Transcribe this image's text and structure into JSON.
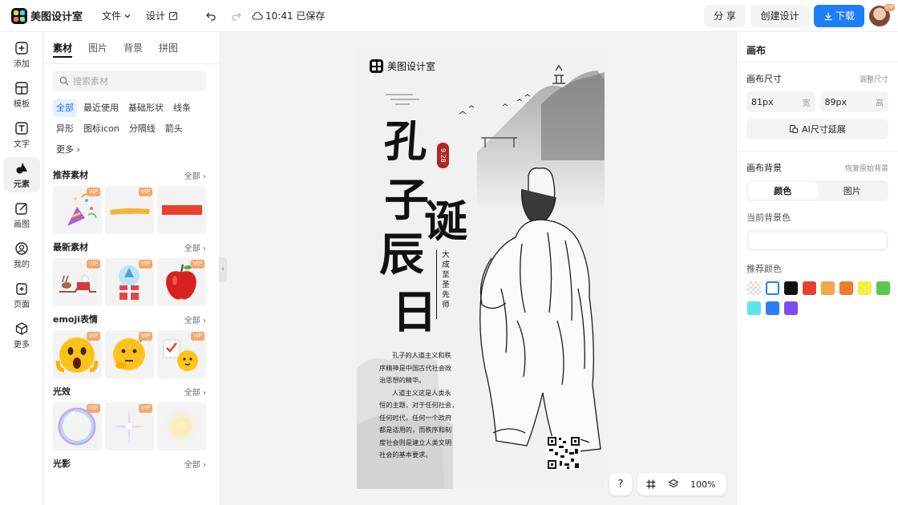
{
  "app": {
    "name": "美图设计室"
  },
  "topbar": {
    "file_label": "文件",
    "design_label": "设计",
    "save_status": "10:41 已保存",
    "share_label": "分 享",
    "create_label": "创建设计",
    "download_label": "下载",
    "avatar_badge": "VIP"
  },
  "leftnav": [
    {
      "label": "添加",
      "icon": "plus-square-icon"
    },
    {
      "label": "模板",
      "icon": "template-icon"
    },
    {
      "label": "文字",
      "icon": "text-icon"
    },
    {
      "label": "元素",
      "icon": "shapes-icon"
    },
    {
      "label": "画图",
      "icon": "draw-icon"
    },
    {
      "label": "我的",
      "icon": "user-icon"
    },
    {
      "label": "页面",
      "icon": "page-icon"
    },
    {
      "label": "更多",
      "icon": "cube-icon"
    }
  ],
  "panel": {
    "tabs": [
      "素材",
      "图片",
      "背景",
      "拼图"
    ],
    "search_placeholder": "搜索素材",
    "chips": [
      "全部",
      "最近使用",
      "基础形状",
      "线条",
      "异形",
      "图标icon",
      "分隔线",
      "箭头",
      "更多"
    ],
    "all_label": "全部",
    "vip_label": "VIP",
    "sections": [
      {
        "title": "推荐素材"
      },
      {
        "title": "最新素材"
      },
      {
        "title": "emoji表情"
      },
      {
        "title": "光效"
      },
      {
        "title": "光影"
      }
    ]
  },
  "poster": {
    "brand": "美图设计室",
    "title_chars": [
      "孔",
      "子",
      "诞",
      "辰",
      "日"
    ],
    "date_tag": "9.28",
    "subtitle": "大成至圣先师",
    "body": [
      "孔子的人道主义和秩",
      "序精神是中国古代社会政",
      "治思想的精华。",
      "人道主义这是人类永",
      "恒的主题，对于任何社会，",
      "任何时代，任何一个政府",
      "都是适用的，而秩序和制",
      "度社会则是建立人类文明",
      "社会的基本要求。"
    ]
  },
  "bottom_tools": {
    "help": "?",
    "zoom": "100%"
  },
  "rightpanel": {
    "title": "画布",
    "size_label": "画布尺寸",
    "adjust_size": "调整尺寸",
    "width_value": "81px",
    "width_unit": "宽",
    "height_value": "89px",
    "height_unit": "高",
    "ai_extend": "AI尺寸延展",
    "bg_label": "画布背景",
    "restore_bg": "恢复原始背景",
    "bg_tabs": [
      "颜色",
      "图片"
    ],
    "current_bg": "当前背景色",
    "recommend": "推荐颜色",
    "colors": [
      "transparent",
      "#ffffff",
      "#111111",
      "#e8412c",
      "#f5a54a",
      "#ef7b2c",
      "#f6ee45",
      "#57c84d",
      "#5ce3ee",
      "#2d7df6",
      "#7d4cf0"
    ]
  }
}
